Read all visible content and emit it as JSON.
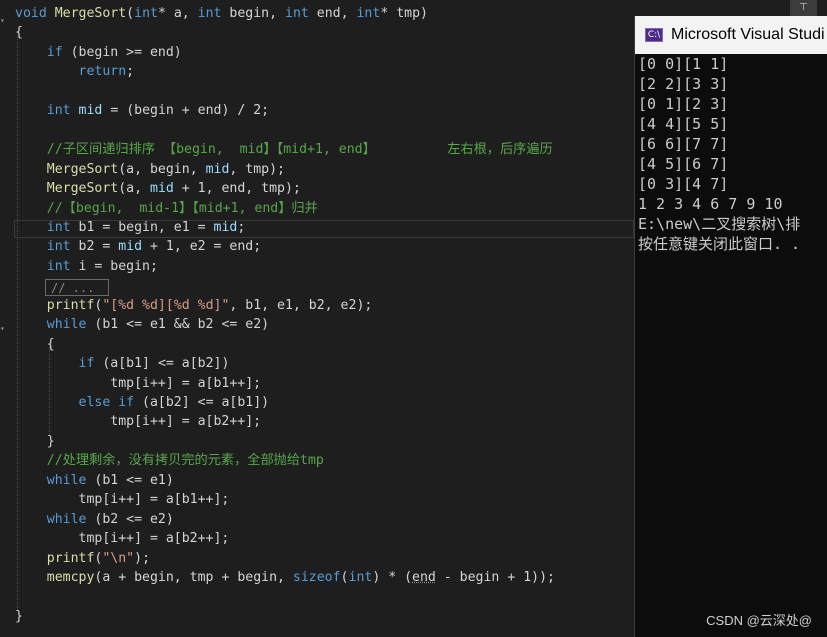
{
  "console": {
    "title": "Microsoft Visual Studi",
    "icon_text": "C:\\",
    "output": [
      "[0 0][1 1]",
      "[2 2][3 3]",
      "[0 1][2 3]",
      "[4 4][5 5]",
      "[6 6][7 7]",
      "[4 5][6 7]",
      "[0 3][4 7]",
      "1 2 3 4 6 7 9 10",
      "E:\\new\\二叉搜索树\\排",
      "按任意键关闭此窗口. ."
    ]
  },
  "editor": {
    "collapsed_label": "// ...",
    "lines": [
      [
        [
          "kw",
          "void "
        ],
        [
          "fn",
          "MergeSort"
        ],
        [
          "p",
          "("
        ],
        [
          "kw",
          "int"
        ],
        [
          "p",
          "* a, "
        ],
        [
          "kw",
          "int"
        ],
        [
          "p",
          " begin, "
        ],
        [
          "kw",
          "int"
        ],
        [
          "p",
          " end, "
        ],
        [
          "kw",
          "int"
        ],
        [
          "p",
          "* tmp)"
        ]
      ],
      [
        [
          "p",
          "{"
        ]
      ],
      [
        [
          "p",
          "    "
        ],
        [
          "kw",
          "if"
        ],
        [
          "p",
          " (begin >= end)"
        ]
      ],
      [
        [
          "p",
          "        "
        ],
        [
          "kw",
          "return"
        ],
        [
          "p",
          ";"
        ]
      ],
      [],
      [
        [
          "p",
          "    "
        ],
        [
          "kw",
          "int"
        ],
        [
          "p",
          " "
        ],
        [
          "var",
          "mid"
        ],
        [
          "p",
          " = (begin + end) / 2;"
        ]
      ],
      [],
      [
        [
          "p",
          "    "
        ],
        [
          "cmt",
          "//子区间递归排序 【begin,  mid】【mid+1, end】         左右根，后序遍历"
        ]
      ],
      [
        [
          "p",
          "    "
        ],
        [
          "fn",
          "MergeSort"
        ],
        [
          "p",
          "(a, begin, "
        ],
        [
          "var",
          "mid"
        ],
        [
          "p",
          ", tmp);"
        ]
      ],
      [
        [
          "p",
          "    "
        ],
        [
          "fn",
          "MergeSort"
        ],
        [
          "p",
          "(a, "
        ],
        [
          "var",
          "mid"
        ],
        [
          "p",
          " + 1, end, tmp);"
        ]
      ],
      [
        [
          "p",
          "    "
        ],
        [
          "cmt",
          "//【begin,  mid-1】【mid+1, end】归并"
        ]
      ],
      [
        [
          "p",
          "    "
        ],
        [
          "kw",
          "int"
        ],
        [
          "p",
          " b1 = begin, e1 = "
        ],
        [
          "var",
          "mid"
        ],
        [
          "p",
          ";"
        ]
      ],
      [
        [
          "p",
          "    "
        ],
        [
          "kw",
          "int"
        ],
        [
          "p",
          " b2 = "
        ],
        [
          "var",
          "mid"
        ],
        [
          "p",
          " + 1, e2 = end;"
        ]
      ],
      [
        [
          "p",
          "    "
        ],
        [
          "kw",
          "int"
        ],
        [
          "p",
          " i = begin;"
        ]
      ],
      [],
      [
        [
          "p",
          "    "
        ],
        [
          "fn",
          "printf"
        ],
        [
          "p",
          "("
        ],
        [
          "str",
          "\"[%d %d][%d %d]\""
        ],
        [
          "p",
          ", b1, e1, b2, e2);"
        ]
      ],
      [
        [
          "p",
          "    "
        ],
        [
          "kw",
          "while"
        ],
        [
          "p",
          " (b1 <= e1 && b2 <= e2)"
        ]
      ],
      [
        [
          "p",
          "    {"
        ]
      ],
      [
        [
          "p",
          "        "
        ],
        [
          "kw",
          "if"
        ],
        [
          "p",
          " (a[b1] <= a[b2])"
        ]
      ],
      [
        [
          "p",
          "            tmp[i++] = a[b1++];"
        ]
      ],
      [
        [
          "p",
          "        "
        ],
        [
          "kw",
          "else if"
        ],
        [
          "p",
          " (a[b2] <= a[b1])"
        ]
      ],
      [
        [
          "p",
          "            tmp[i++] = a[b2++];"
        ]
      ],
      [
        [
          "p",
          "    }"
        ]
      ],
      [
        [
          "p",
          "    "
        ],
        [
          "cmt",
          "//处理剩余，没有拷贝完的元素，全部抛给tmp"
        ]
      ],
      [
        [
          "p",
          "    "
        ],
        [
          "kw",
          "while"
        ],
        [
          "p",
          " (b1 <= e1)"
        ]
      ],
      [
        [
          "p",
          "        tmp[i++] = a[b1++];"
        ]
      ],
      [
        [
          "p",
          "    "
        ],
        [
          "kw",
          "while"
        ],
        [
          "p",
          " (b2 <= e2)"
        ]
      ],
      [
        [
          "p",
          "        tmp[i++] = a[b2++];"
        ]
      ],
      [
        [
          "p",
          "    "
        ],
        [
          "fn",
          "printf"
        ],
        [
          "p",
          "("
        ],
        [
          "str",
          "\"\\n\""
        ],
        [
          "p",
          ");"
        ]
      ],
      [
        [
          "p",
          "    "
        ],
        [
          "fn",
          "memcpy"
        ],
        [
          "p",
          "(a + begin, tmp + begin, "
        ],
        [
          "kw",
          "sizeof"
        ],
        [
          "p",
          "("
        ],
        [
          "kw",
          "int"
        ],
        [
          "p",
          ") * ("
        ],
        [
          "u",
          "end"
        ],
        [
          "p",
          " - begin + 1));"
        ]
      ],
      [],
      [
        [
          "p",
          "}"
        ]
      ]
    ]
  },
  "watermark": "CSDN @云深处@",
  "toolbar": {
    "pin_icon": "pin-icon"
  },
  "colors": {
    "keyword": "#569cd6",
    "function": "#dcdcaa",
    "comment": "#57a64a",
    "string": "#d69d85",
    "background": "#1e1e1e"
  }
}
